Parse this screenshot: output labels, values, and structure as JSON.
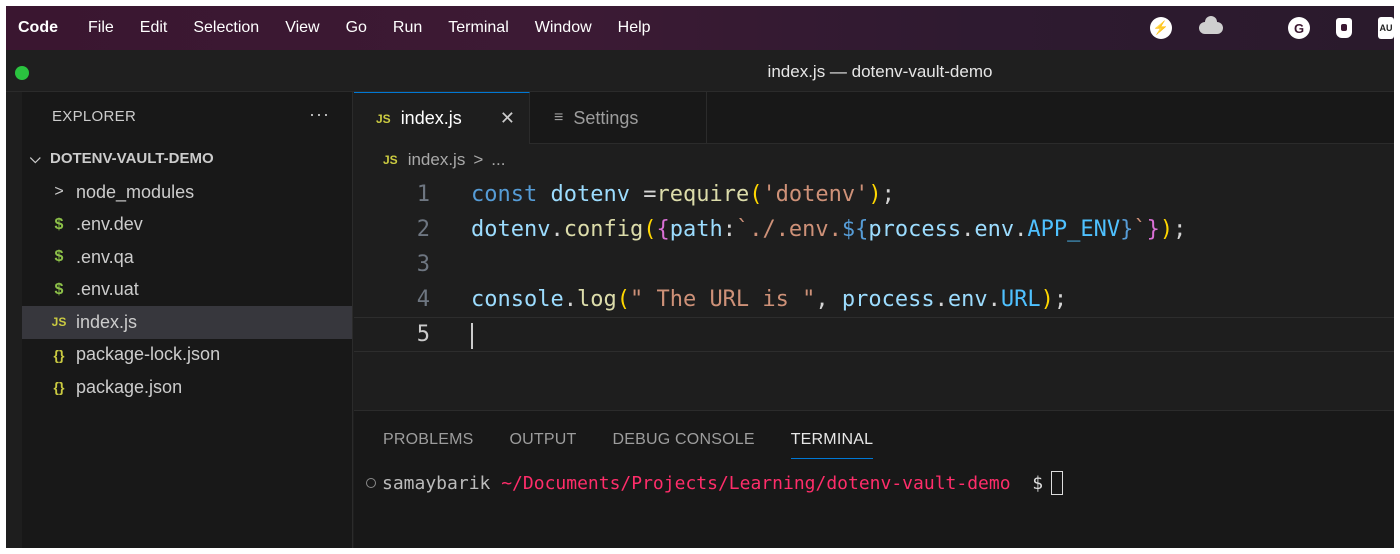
{
  "menubar": {
    "app": "Code",
    "items": [
      "File",
      "Edit",
      "Selection",
      "View",
      "Go",
      "Run",
      "Terminal",
      "Window",
      "Help"
    ],
    "icons": [
      "bolt-icon",
      "cloud-icon",
      "grammarly-icon",
      "lock-icon",
      "user-icon"
    ],
    "user_badge": "AU"
  },
  "window": {
    "title": "index.js — dotenv-vault-demo"
  },
  "sidebar": {
    "header": "EXPLORER",
    "more": "···",
    "project": "DOTENV-VAULT-DEMO",
    "items": [
      {
        "icon": ">",
        "label": "node_modules"
      },
      {
        "icon": "$",
        "label": ".env.dev"
      },
      {
        "icon": "$",
        "label": ".env.qa"
      },
      {
        "icon": "$",
        "label": ".env.uat"
      },
      {
        "icon": "JS",
        "label": "index.js"
      },
      {
        "icon": "{}",
        "label": "package-lock.json"
      },
      {
        "icon": "{}",
        "label": "package.json"
      }
    ]
  },
  "tabs": {
    "active": {
      "badge": "JS",
      "label": "index.js",
      "close": "✕"
    },
    "inactive": {
      "icon": "≡",
      "label": "Settings"
    }
  },
  "breadcrumb": {
    "badge": "JS",
    "file": "index.js",
    "sep": ">",
    "rest": "..."
  },
  "editor": {
    "line_numbers": [
      "1",
      "2",
      "3",
      "4",
      "5"
    ],
    "line1": {
      "kw": "const",
      "var": "dotenv",
      "eq": " =",
      "fn": "require",
      "open": "(",
      "str": "'dotenv'",
      "close": ")",
      "semi": ";"
    },
    "line2": {
      "obj": "dotenv",
      "dot": ".",
      "fn": "config",
      "p1": "(",
      "b1": "{",
      "key": "path",
      "colon": ":",
      "str": "`./.env.",
      "dollar": "${",
      "v1": "process",
      "d1": ".",
      "v2": "env",
      "d2": ".",
      "cst": "APP_ENV",
      "rb": "}",
      "tick": "`",
      "b2": "}",
      "p2": ")",
      "semi": ";"
    },
    "line4": {
      "obj": "console",
      "dot": ".",
      "fn": "log",
      "p1": "(",
      "str": "\" The URL is \"",
      "comma": ", ",
      "v1": "process",
      "d1": ".",
      "v2": "env",
      "d2": ".",
      "cst": "URL",
      "p2": ")",
      "semi": ";"
    }
  },
  "panel": {
    "tabs": [
      "PROBLEMS",
      "OUTPUT",
      "DEBUG CONSOLE",
      "TERMINAL"
    ],
    "terminal": {
      "user": "samaybarik ",
      "path": "~/Documents/Projects/Learning/dotenv-vault-demo",
      "prompt": "  $"
    }
  }
}
